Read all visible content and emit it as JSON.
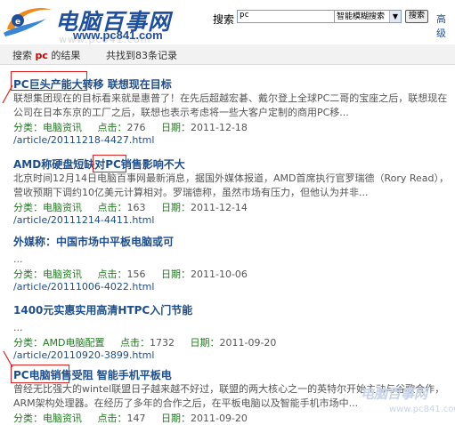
{
  "header": {
    "logo_text": "电脑百事网",
    "logo_url": "www.pc841.com",
    "ghost_url": "www.pc841.com",
    "search_label": "搜索",
    "search_value": "pc",
    "search_mode": "智能模糊搜索",
    "search_button": "搜索",
    "adv_link": "高级"
  },
  "result_bar": {
    "label_prefix": "搜索",
    "keyword": "pc",
    "label_suffix": "的结果",
    "count_text": "共找到83条记录"
  },
  "articles": [
    {
      "title": "PC巨头产能大转移 联想现在目标",
      "summary_1": "联想集团现在的目标看来就是惠普了！在先后超越宏碁、戴尔登上全球PC二哥的宝座之后，联想现在",
      "summary_2": "公司在日本东京的工厂之后，联想也表示考虑将一些大客户定制的商用PC移...",
      "category": "分类：电脑资讯",
      "click_label": "点击：",
      "clicks": "276",
      "date_label": "日期：",
      "date": "2011-12-18",
      "link": "/article/20111218-4427.html"
    },
    {
      "title": "AMD称硬盘短缺对PC销售影响不大",
      "summary_1": "北京时间12月14日电脑百事网最新消息，据国外媒体报道，AMD首席执行官罗瑞德（Rory Read），",
      "summary_2": "营收预期下调约10亿美元计算相对。罗瑞德称，虽然市场有压力，但他认为并非...",
      "category": "分类：电脑资讯",
      "click_label": "点击：",
      "clicks": "163",
      "date_label": "日期：",
      "date": "2011-12-14",
      "link": "/article/20111214-4411.html"
    },
    {
      "title": "外媒称：中国市场中平板电脑或可",
      "summary_1": "...",
      "summary_2": "",
      "category": "分类：电脑资讯",
      "click_label": "点击：",
      "clicks": "156",
      "date_label": "日期：",
      "date": "2011-10-06",
      "link": "/article/20111006-4022.html"
    },
    {
      "title": "1400元实惠实用高清HTPC入门节能",
      "summary_1": "...",
      "summary_2": "",
      "category": "分类：AMD电脑配置",
      "click_label": "点击：",
      "clicks": "1732",
      "date_label": "日期：",
      "date": "2011-09-20",
      "link": "/article/20110920-3899.html"
    },
    {
      "title": "PC电脑销售受阻 智能手机平板电",
      "summary_1": "曾经无比强大的wintel联盟日子越来越不好过，联盟的两大核心之一的英特尔开始主动与谷歌合作，",
      "summary_2": "ARM架构处理器。在经历了多年的合作之后，在平板电脑以及智能手机市场中...",
      "category": "分类：电脑资讯",
      "click_label": "点击：",
      "clicks": "147",
      "date_label": "日期：",
      "date": "2011-09-20",
      "link": ""
    }
  ],
  "watermark": {
    "text": "电脑百事网",
    "sub": "www.pc841.com"
  },
  "colors": {
    "title_blue": "#1f4e8c",
    "meta_green": "#1f7a1f",
    "annotation_red": "#dd2222"
  }
}
